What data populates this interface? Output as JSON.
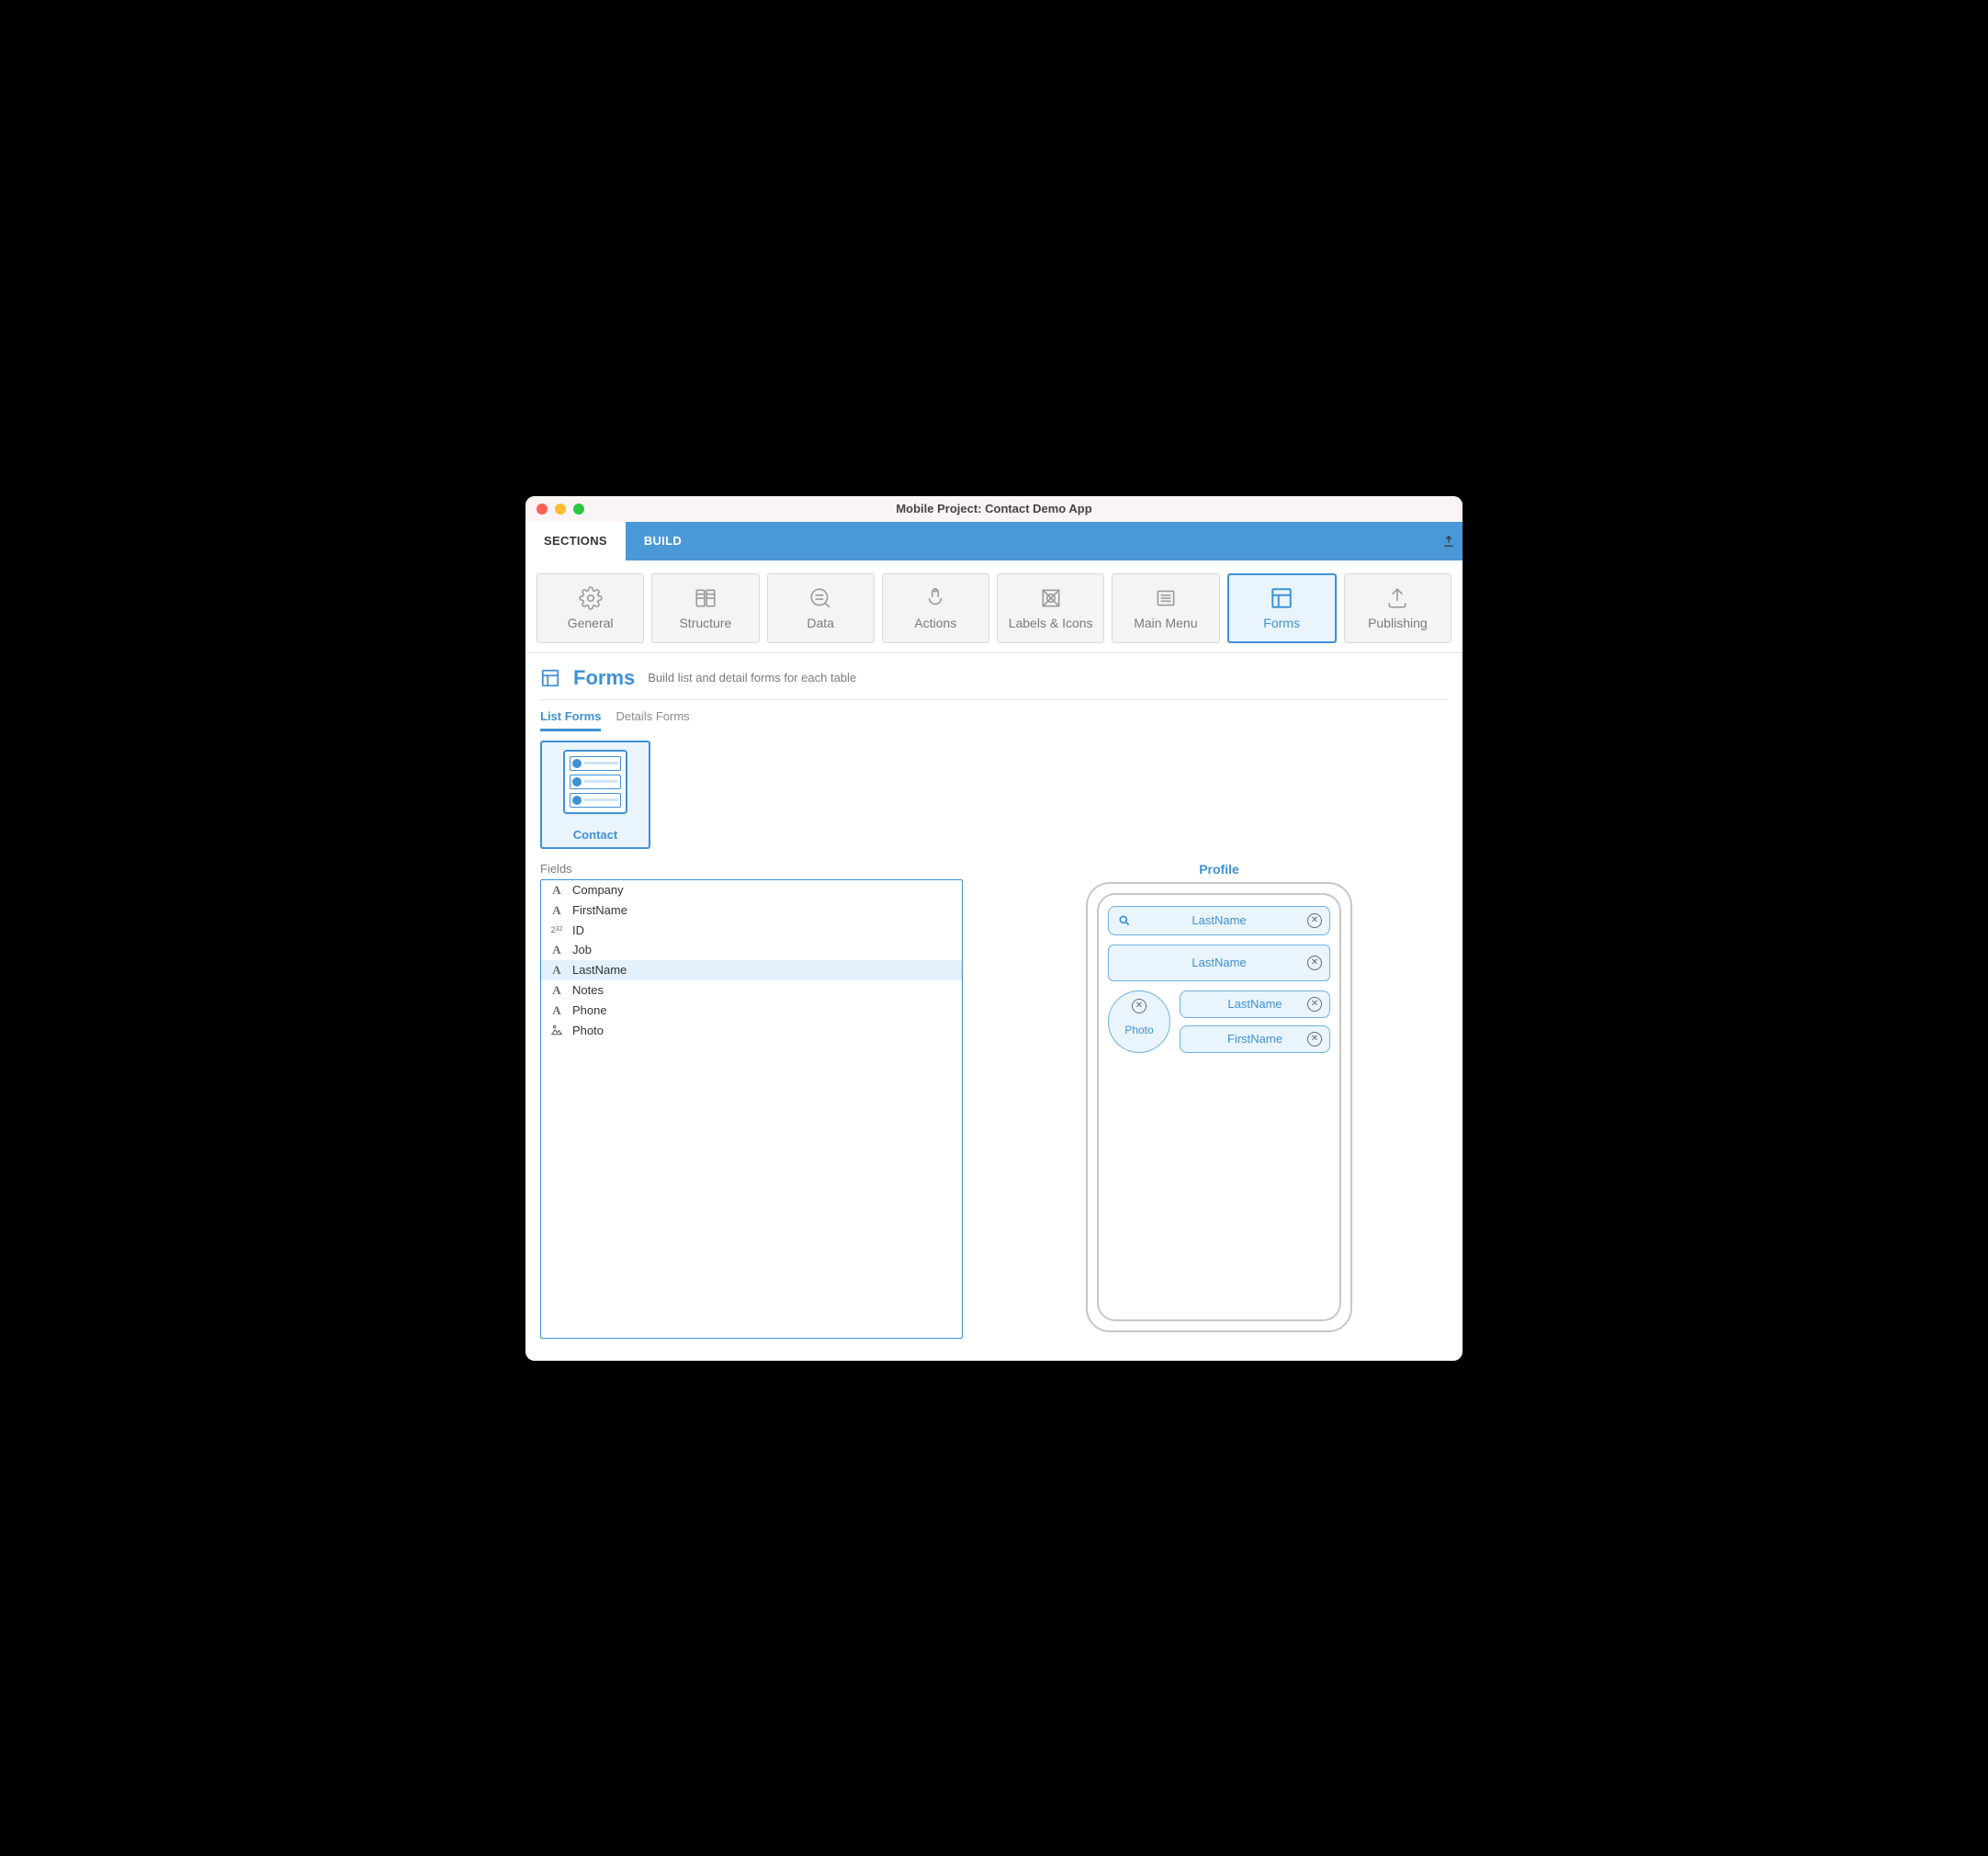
{
  "window": {
    "title": "Mobile Project: Contact Demo App"
  },
  "topTabs": {
    "sections": "SECTIONS",
    "build": "BUILD"
  },
  "sections": [
    {
      "id": "general",
      "label": "General"
    },
    {
      "id": "structure",
      "label": "Structure"
    },
    {
      "id": "data",
      "label": "Data"
    },
    {
      "id": "actions",
      "label": "Actions"
    },
    {
      "id": "labels",
      "label": "Labels & Icons"
    },
    {
      "id": "mainmenu",
      "label": "Main Menu"
    },
    {
      "id": "forms",
      "label": "Forms",
      "selected": true
    },
    {
      "id": "publishing",
      "label": "Publishing"
    }
  ],
  "subheader": {
    "title": "Forms",
    "desc": "Build list and detail forms for each table"
  },
  "viewTabs": {
    "list": "List Forms",
    "details": "Details Forms"
  },
  "tableCard": {
    "label": "Contact"
  },
  "fieldsPanel": {
    "title": "Fields",
    "items": [
      {
        "type": "text",
        "name": "Company"
      },
      {
        "type": "text",
        "name": "FirstName"
      },
      {
        "type": "int32",
        "name": "ID"
      },
      {
        "type": "text",
        "name": "Job"
      },
      {
        "type": "text",
        "name": "LastName",
        "selected": true
      },
      {
        "type": "text",
        "name": "Notes"
      },
      {
        "type": "text",
        "name": "Phone"
      },
      {
        "type": "image",
        "name": "Photo"
      }
    ]
  },
  "preview": {
    "title": "Profile",
    "search": "LastName",
    "section": "LastName",
    "photo": "Photo",
    "row1": "LastName",
    "row2": "FirstName"
  }
}
